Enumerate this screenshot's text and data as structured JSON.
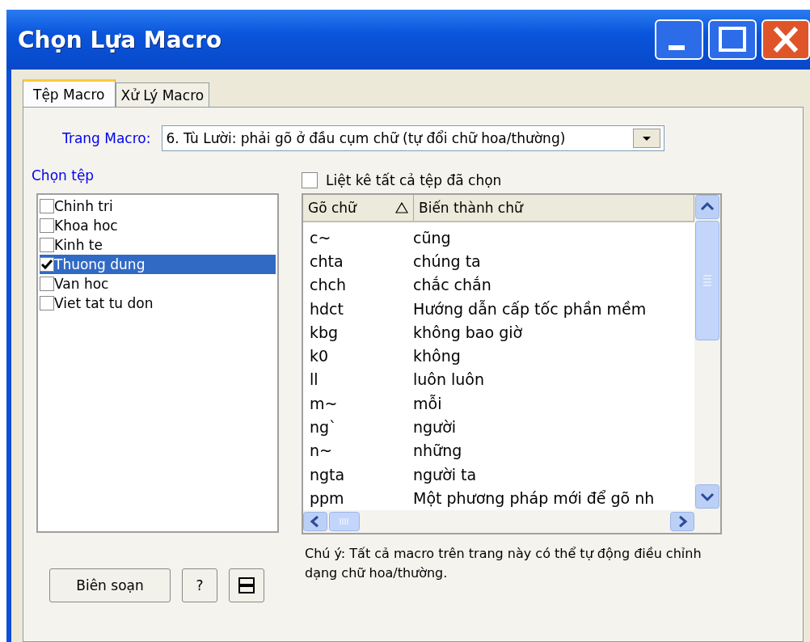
{
  "window": {
    "title": "Chọn Lựa Macro"
  },
  "tabs": [
    {
      "label": "Tệp Macro",
      "selected": true
    },
    {
      "label": "Xử Lý Macro",
      "selected": false
    }
  ],
  "macro_page": {
    "label": "Trang Macro:",
    "value": "6. Tù Lười: phải gõ ở đầu cụm chữ (tự đổi chữ hoa/thường)"
  },
  "file_list": {
    "label": "Chọn tệp",
    "items": [
      {
        "label": "Chinh tri",
        "checked": false,
        "selected": false
      },
      {
        "label": "Khoa hoc",
        "checked": false,
        "selected": false
      },
      {
        "label": "Kinh te",
        "checked": false,
        "selected": false
      },
      {
        "label": "Thuong dung",
        "checked": true,
        "selected": true
      },
      {
        "label": "Van hoc",
        "checked": false,
        "selected": false
      },
      {
        "label": "Viet tat tu don",
        "checked": false,
        "selected": false
      }
    ]
  },
  "list_all": {
    "label": "Liệt kê tất cả tệp đã chọn",
    "checked": false
  },
  "table": {
    "columns": [
      {
        "label": "Gõ chữ",
        "sorted": true
      },
      {
        "label": "Biến thành chữ",
        "sorted": false
      }
    ],
    "rows": [
      [
        "c~",
        "cũng"
      ],
      [
        "chta",
        "chúng ta"
      ],
      [
        "chch",
        "chắc chắn"
      ],
      [
        "hdct",
        "Hướng dẫn cấp tốc phần mềm"
      ],
      [
        "kbg",
        "không bao giờ"
      ],
      [
        "k0",
        "không"
      ],
      [
        "ll",
        "luôn luôn"
      ],
      [
        "m~",
        "mỗi"
      ],
      [
        "ng`",
        "người"
      ],
      [
        "n~",
        "những"
      ],
      [
        "ngta",
        "người ta"
      ],
      [
        "ppm",
        "Một phương pháp mới để gõ nh"
      ]
    ]
  },
  "note": "Chú ý: Tất cả macro trên trang này có thể tự động điều chỉnh dạng chữ hoa/thường.",
  "buttons": [
    {
      "kind": "text",
      "label": "Biên soạn"
    },
    {
      "kind": "text",
      "label": "?"
    },
    {
      "kind": "icon"
    }
  ]
}
